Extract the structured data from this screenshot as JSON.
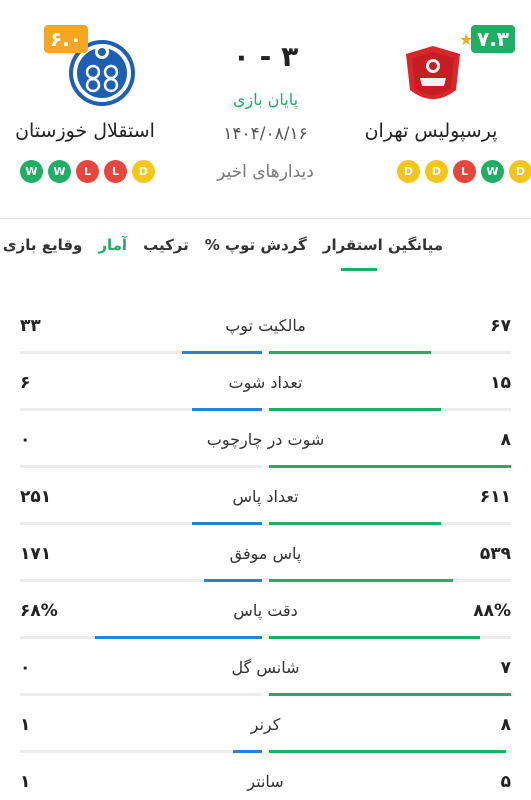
{
  "match": {
    "home": {
      "name": "پرسپولیس تهران",
      "rating": "۷.۳",
      "logo": "persepolis-logo",
      "form": [
        "D",
        "D",
        "L",
        "W",
        "D"
      ]
    },
    "away": {
      "name": "استقلال خوزستان",
      "rating": "۶.۰",
      "logo": "esteghlal-khuzestan-logo",
      "form": [
        "W",
        "W",
        "L",
        "L",
        "D"
      ]
    },
    "score": "۳ - ۰",
    "status": "پایان بازی",
    "date": "۱۴۰۴/۰۸/۱۶",
    "recent_label": "دیدارهای اخیر"
  },
  "colors": {
    "home": "#1fae63",
    "away": "#2b83d0",
    "win": "#1fae63",
    "draw": "#f5c518",
    "loss": "#e8463d"
  },
  "tabs": [
    {
      "label": "وقایع بازی",
      "active": false
    },
    {
      "label": "آمار",
      "active": true
    },
    {
      "label": "ترکیب",
      "active": false
    },
    {
      "label": "گردش توپ %",
      "active": false
    },
    {
      "label": "میانگین استقرار",
      "active": false
    }
  ],
  "stats": [
    {
      "label": "مالکیت توپ",
      "home": "۶۷",
      "away": "۳۳",
      "home_share": 0.67,
      "away_share": 0.33
    },
    {
      "label": "تعداد شوت",
      "home": "۱۵",
      "away": "۶",
      "home_share": 0.71,
      "away_share": 0.29
    },
    {
      "label": "شوت در چارچوب",
      "home": "۸",
      "away": "۰",
      "home_share": 1.0,
      "away_share": 0.0
    },
    {
      "label": "تعداد پاس",
      "home": "۶۱۱",
      "away": "۲۵۱",
      "home_share": 0.71,
      "away_share": 0.29
    },
    {
      "label": "پاس موفق",
      "home": "۵۳۹",
      "away": "۱۷۱",
      "home_share": 0.76,
      "away_share": 0.24
    },
    {
      "label": "دقت پاس",
      "home": "۸۸%",
      "away": "۶۸%",
      "home_share": 0.87,
      "away_share": 0.69
    },
    {
      "label": "شانس گل",
      "home": "۷",
      "away": "۰",
      "home_share": 1.0,
      "away_share": 0.0
    },
    {
      "label": "کرنر",
      "home": "۸",
      "away": "۱",
      "home_share": 0.98,
      "away_share": 0.12
    },
    {
      "label": "سانتر",
      "home": "۵",
      "away": "۱",
      "home_share": 0.83,
      "away_share": 0.17
    }
  ]
}
